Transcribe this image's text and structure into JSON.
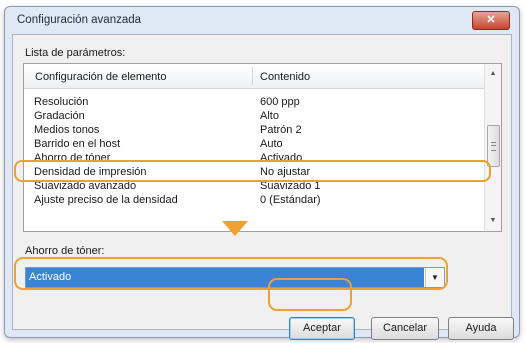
{
  "window": {
    "title": "Configuración avanzada",
    "close_label": "✕"
  },
  "parameter_list": {
    "caption": "Lista de parámetros:",
    "columns": [
      "Configuración de elemento",
      "Contenido"
    ],
    "rows": [
      {
        "item": "Resolución",
        "value": "600 ppp"
      },
      {
        "item": "Gradación",
        "value": "Alto"
      },
      {
        "item": "Medios tonos",
        "value": "Patrón 2"
      },
      {
        "item": "Barrido en el host",
        "value": "Auto"
      },
      {
        "item": "Ahorro de tóner",
        "value": "Activado"
      },
      {
        "item": "Densidad de impresión",
        "value": "No ajustar"
      },
      {
        "item": "Suavizado avanzado",
        "value": "Suavizado 1"
      },
      {
        "item": "Ajuste preciso de la densidad",
        "value": "0 (Estándar)"
      }
    ],
    "selected_row_index": 4
  },
  "setting": {
    "caption": "Ahorro de tóner:",
    "selected_value": "Activado"
  },
  "buttons": {
    "ok": "Aceptar",
    "cancel": "Cancelar",
    "help": "Ayuda"
  },
  "colors": {
    "highlight": "#f0a030",
    "selection": "#3a84d8"
  },
  "icons": {
    "scroll_up": "▲",
    "scroll_down": "▼",
    "dropdown": "▼"
  }
}
